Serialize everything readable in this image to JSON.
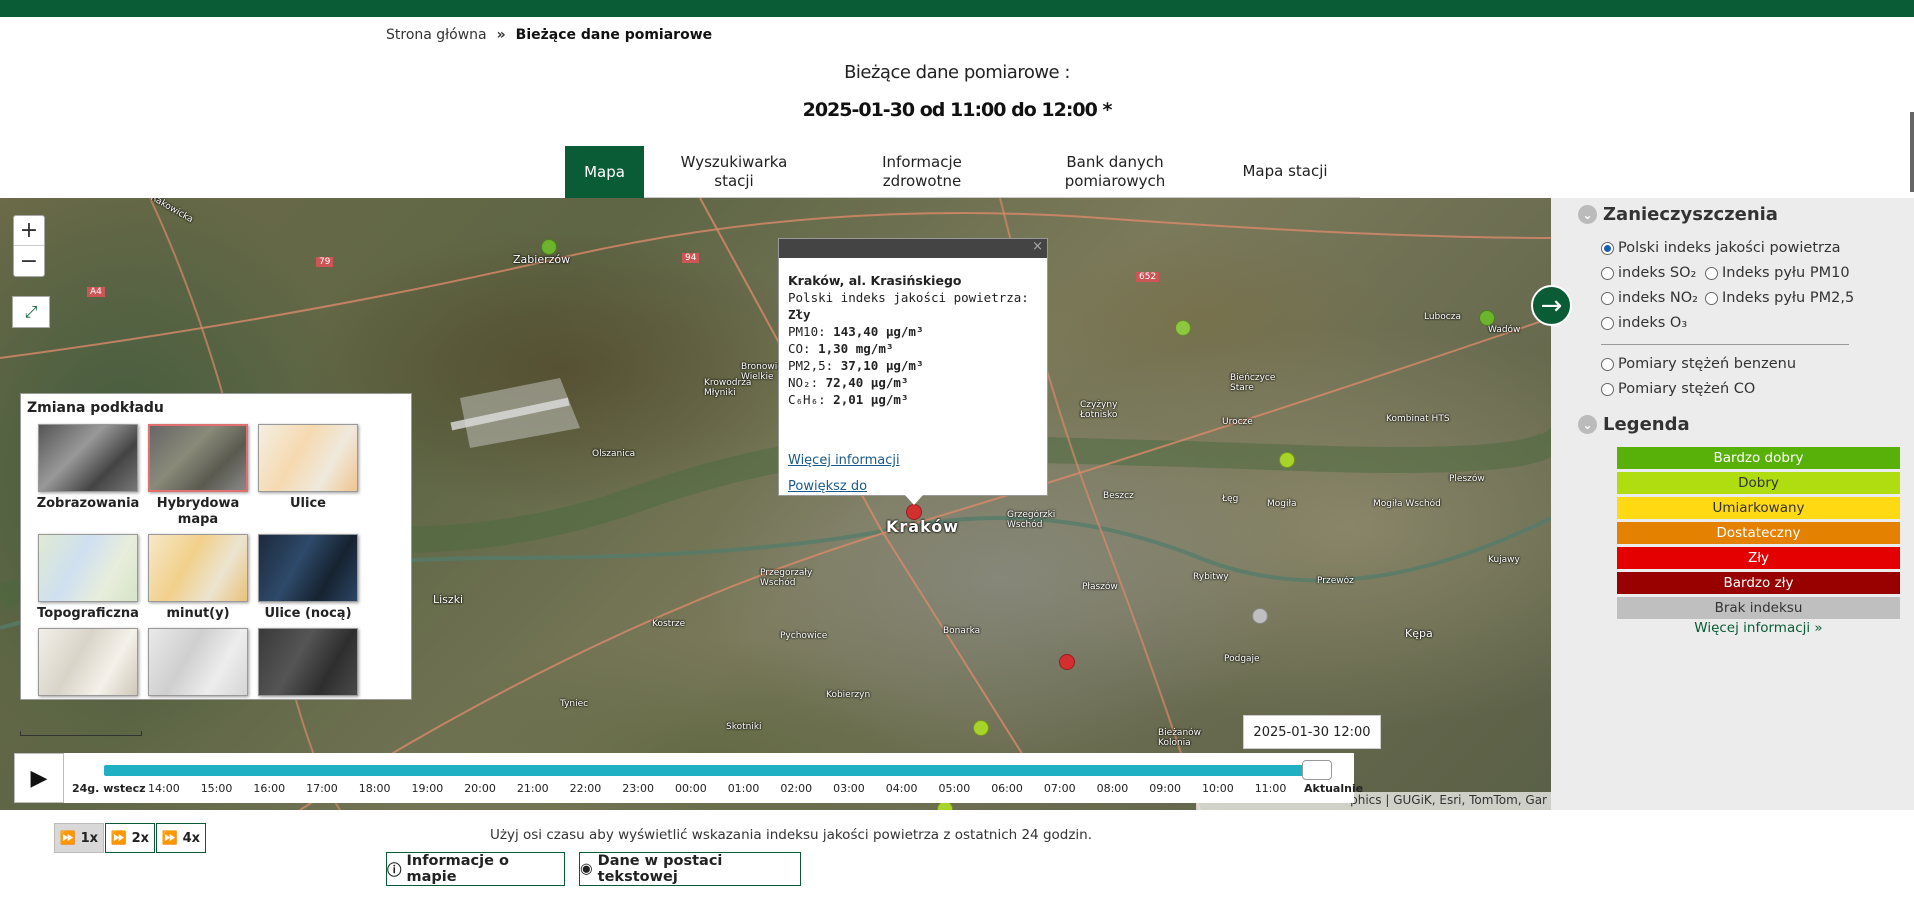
{
  "breadcrumb": {
    "home": "Strona główna",
    "sep": "»",
    "current": "Bieżące dane pomiarowe"
  },
  "title": {
    "line1": "Bieżące dane pomiarowe :",
    "line2": "2025-01-30 od 11:00 do 12:00 *"
  },
  "tabs": [
    {
      "label": "Mapa",
      "active": true
    },
    {
      "label": "Wyszukiwarka stacji"
    },
    {
      "label": "Informacje zdrowotne"
    },
    {
      "label": "Bank danych pomiarowych"
    },
    {
      "label": "Mapa stacji"
    }
  ],
  "map": {
    "zoom_in": "+",
    "zoom_out": "−",
    "fullscreen": "⤢",
    "labels": {
      "krakow": "Kraków",
      "zabierzow": "Zabierzów",
      "liszki": "Liszki",
      "kostrze": "Kostrze",
      "tyniec": "Tyniec",
      "kobierzyn": "Kobierzyn",
      "skotniki": "Skotniki",
      "bonarka": "Bonarka",
      "pychowice": "Pychowice",
      "przegorzaly": "Przegorzały Wschód",
      "olszanica": "Olszanica",
      "kepa": "Kępa",
      "podgaje": "Podgaje",
      "rybitwy": "Rybitwy",
      "plaszow": "Płaszów",
      "mogila": "Mogiła",
      "mogila_wschod": "Mogiła Wschód",
      "kombinat": "Kombinat HTS",
      "lubocza": "Lubocza",
      "wadow": "Wadów",
      "pleszow": "Pleszów",
      "przewoz": "Przewóz",
      "kujawy": "Kujawy",
      "bienczyce": "Bieńczyce Stare",
      "urocze": "Urocze",
      "czyzyny": "Czyżyny Łotnisko",
      "grzegorzki": "Grzegórzki Wschód",
      "lęg": "Łęg",
      "bieżanow": "Bieżanów Kolonia",
      "bronowice": "Bronowice Wielkie",
      "krowodrza": "Krowodrza Młyniki",
      "rakowicka": "Rakowicka",
      "a4": "A4",
      "r79": "79",
      "r94": "94",
      "r652": "652"
    },
    "basemap": {
      "title": "Zmiana podkładu",
      "items": [
        {
          "label": "Zobrazowania",
          "style": "imagery"
        },
        {
          "label": "Hybrydowa mapa",
          "style": "hybrid",
          "selected": true
        },
        {
          "label": "Ulice",
          "style": "streets"
        },
        {
          "label": "Topograficzna",
          "style": "topo"
        },
        {
          "label": "minut(y)",
          "style": "navigation"
        },
        {
          "label": "Ulice (nocą)",
          "style": "night"
        },
        {
          "label": "",
          "style": "terrain"
        },
        {
          "label": "",
          "style": "gray"
        },
        {
          "label": "",
          "style": "dark"
        }
      ]
    },
    "popup": {
      "close": "×",
      "station": "Kraków, al. Krasińskiego",
      "index_label": "Polski indeks jakości powietrza:",
      "index_value": "Zły",
      "rows": [
        {
          "label": "PM10:",
          "value": "143,40 µg/m³"
        },
        {
          "label": "CO:",
          "value": "1,30 mg/m³"
        },
        {
          "label": "PM2,5:",
          "value": "37,10 µg/m³"
        },
        {
          "label": "NO₂:",
          "value": "72,40 µg/m³"
        },
        {
          "label": "C₆H₆:",
          "value": "2,01 µg/m³"
        }
      ],
      "more_link": "Więcej informacji",
      "zoom_link": "Powiększ do"
    },
    "next_arrow": "→",
    "date_box": "2025-01-30 12:00",
    "attribution": "phics | GUGiK, Esri, TomTom, Gar"
  },
  "timeline": {
    "play": "▶",
    "ticks": [
      "24g. wstecz",
      "14:00",
      "15:00",
      "16:00",
      "17:00",
      "18:00",
      "19:00",
      "20:00",
      "21:00",
      "22:00",
      "23:00",
      "00:00",
      "01:00",
      "02:00",
      "03:00",
      "04:00",
      "05:00",
      "06:00",
      "07:00",
      "08:00",
      "09:00",
      "10:00",
      "11:00",
      "Aktualnie"
    ],
    "progress": 1.0,
    "hint": "Użyj osi czasu aby wyświetlić wskazania indeksu jakości powietrza z ostatnich 24 godzin."
  },
  "speed": [
    {
      "label": "1x",
      "active": true
    },
    {
      "label": "2x"
    },
    {
      "label": "4x"
    }
  ],
  "buttons": {
    "map_info": "Informacje o mapie",
    "text_data": "Dane w postaci tekstowej"
  },
  "sidebar": {
    "pollution_heading": "Zanieczyszczenia",
    "options": {
      "aqi": "Polski indeks jakości powietrza",
      "so2": "indeks SO₂",
      "pm10": "Indeks pyłu PM10",
      "no2": "indeks NO₂",
      "pm25": "Indeks pyłu PM2,5",
      "o3": "indeks O₃",
      "benzene": "Pomiary stężeń benzenu",
      "co": "Pomiary stężeń CO"
    },
    "selected_option": "aqi",
    "legend_heading": "Legenda",
    "legend": [
      {
        "label": "Bardzo dobry",
        "color": "#57b108"
      },
      {
        "label": "Dobry",
        "color": "#b0dd10"
      },
      {
        "label": "Umiarkowany",
        "color": "#ffd911"
      },
      {
        "label": "Dostateczny",
        "color": "#e58100"
      },
      {
        "label": "Zły",
        "color": "#e50000"
      },
      {
        "label": "Bardzo zły",
        "color": "#990000"
      },
      {
        "label": "Brak indeksu",
        "color": "#bfbfbf"
      }
    ],
    "more_link": "Więcej informacji »"
  },
  "colors": {
    "brand": "#0a5c36",
    "timeline": "#1fb0c4"
  }
}
